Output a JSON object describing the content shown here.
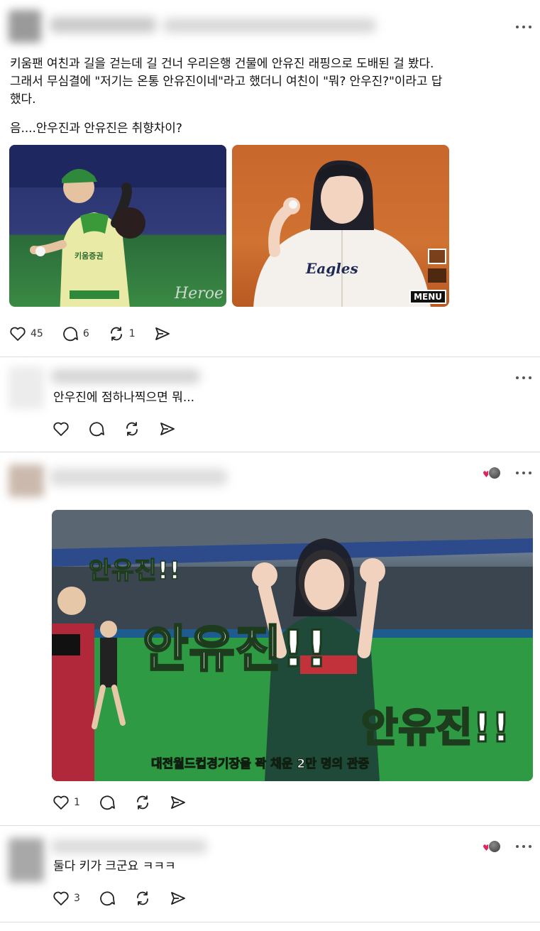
{
  "post": {
    "text_line1": "키움팬 여친과 길을 걷는데 길 건너 우리은행 건물에 안유진 래핑으로 도배된 걸 봤다.",
    "text_line2": "그래서 무심결에 \"저기는 온통 안유진이네\"라고 했더니 여친이 \"뭐? 안우진?\"이라고 답",
    "text_line3": "했다.",
    "text_line4": "음....안우진과 안유진은 취향차이?",
    "image1": {
      "jersey_text": "키움증권",
      "watermark": "Heroe"
    },
    "image2": {
      "jersey_text": "Eagles",
      "menu_label": "MENU"
    },
    "likes": "45",
    "replies": "6",
    "reposts": "1",
    "icons": [
      "heart-icon",
      "comment-icon",
      "repost-icon",
      "share-icon",
      "more-icon"
    ]
  },
  "reply1": {
    "text": "안우진에 점하나찍으면 뭐..."
  },
  "reply2": {
    "image": {
      "caption_small": "안유진!!",
      "caption_center": "안유진!!",
      "caption_right": "안유진!!",
      "subtitle": "대전월드컵경기장을 꽉 채운 2만 명의 관중"
    },
    "likes": "1"
  },
  "reply3": {
    "text": "둘다 키가 크군요 ㅋㅋㅋ",
    "likes": "3"
  },
  "colors": {
    "heart": "#e0245e",
    "divider": "#dcdcdc",
    "text": "#111111"
  }
}
